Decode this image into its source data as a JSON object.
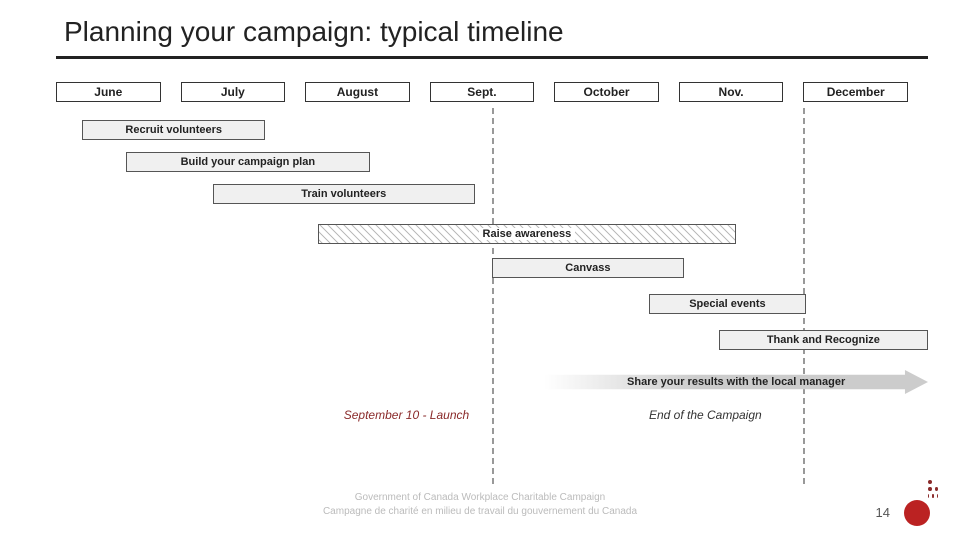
{
  "title": "Planning your campaign: typical timeline",
  "chart_data": {
    "type": "bar",
    "categories": [
      "June",
      "July",
      "August",
      "Sept.",
      "October",
      "Nov.",
      "December"
    ],
    "month_bounds_pct": [
      0,
      14.28,
      28.57,
      42.85,
      57.14,
      71.42,
      85.71,
      100
    ],
    "vlines_at_pct": [
      50.0,
      85.71
    ],
    "series": [
      {
        "name": "Recruit volunteers",
        "start_pct": 3,
        "end_pct": 24,
        "style": "plain"
      },
      {
        "name": "Build your campaign plan",
        "start_pct": 8,
        "end_pct": 36,
        "style": "plain"
      },
      {
        "name": "Train volunteers",
        "start_pct": 18,
        "end_pct": 48,
        "style": "plain"
      },
      {
        "name": "Raise awareness",
        "start_pct": 30,
        "end_pct": 78,
        "style": "hatch"
      },
      {
        "name": "Canvass",
        "start_pct": 50,
        "end_pct": 72,
        "style": "plain"
      },
      {
        "name": "Special events",
        "start_pct": 68,
        "end_pct": 86,
        "style": "plain"
      },
      {
        "name": "Thank and Recognize",
        "start_pct": 76,
        "end_pct": 100,
        "style": "plain"
      },
      {
        "name": "Share your results with the local manager",
        "start_pct": 56,
        "end_pct": 100,
        "style": "arrow"
      }
    ],
    "annotations": [
      {
        "text": "September 10 - Launch",
        "near_pct": 50,
        "color": "maroon"
      },
      {
        "text": "End of the Campaign",
        "near_pct": 85.71,
        "color": "dark"
      }
    ],
    "title": "Planning your campaign: typical timeline"
  },
  "months": {
    "0": "June",
    "1": "July",
    "2": "August",
    "3": "Sept.",
    "4": "October",
    "5": "Nov.",
    "6": "December"
  },
  "bars": {
    "recruit": "Recruit volunteers",
    "plan": "Build your campaign plan",
    "train": "Train volunteers",
    "awareness": "Raise awareness",
    "canvass": "Canvass",
    "events": "Special events",
    "thank": "Thank and Recognize",
    "share": "Share your results with the local manager"
  },
  "notes": {
    "launch": "September 10 - Launch",
    "end": "End of the Campaign"
  },
  "footer": {
    "line1": "Government of Canada Workplace Charitable Campaign",
    "line2": "Campagne de charité en milieu de travail du gouvernement du Canada"
  },
  "page": "14"
}
